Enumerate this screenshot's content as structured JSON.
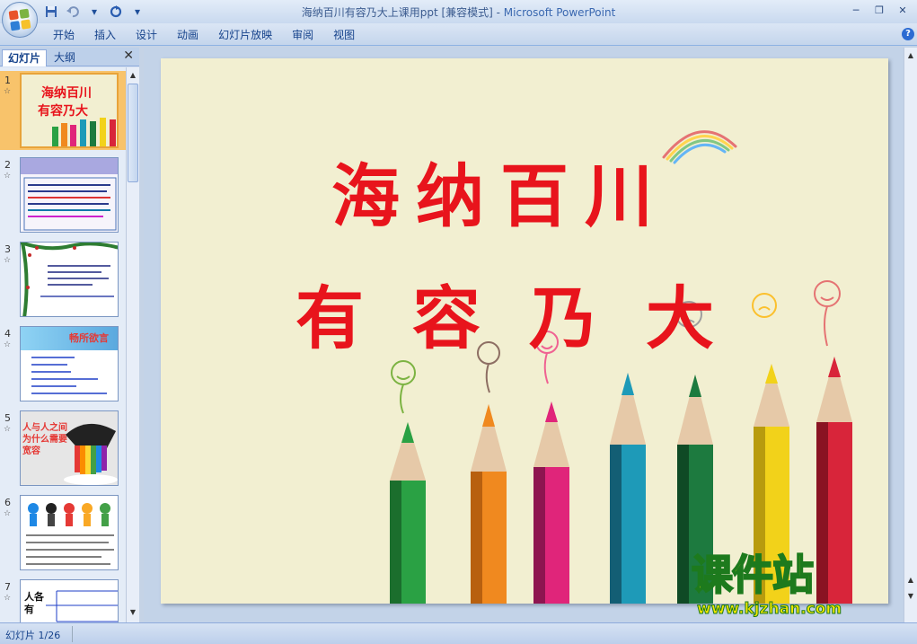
{
  "window": {
    "title": "海纳百川有容乃大上课用ppt [兼容模式]",
    "app_name": "Microsoft PowerPoint",
    "separator": " - "
  },
  "ribbon": {
    "tabs": [
      "开始",
      "插入",
      "设计",
      "动画",
      "幻灯片放映",
      "审阅",
      "视图"
    ]
  },
  "left_pane": {
    "tab_slides": "幻灯片",
    "tab_outline": "大纲",
    "slides": [
      {
        "num": "1",
        "selected": true
      },
      {
        "num": "2"
      },
      {
        "num": "3"
      },
      {
        "num": "4"
      },
      {
        "num": "5"
      },
      {
        "num": "6"
      },
      {
        "num": "7"
      }
    ],
    "thumb_texts": {
      "s1_line1": "海纳百川",
      "s1_line2": "有容乃大",
      "s4_header": "畅所欲言",
      "s5_text": "人与人之间为什么需要宽容",
      "s7_text": "人各有"
    }
  },
  "slide": {
    "line1": "海纳百川",
    "line2": "有容乃大"
  },
  "status": {
    "slide_counter": "幻灯片 1/26"
  },
  "watermark": {
    "brand": "课件站",
    "url": "www.kjzhan.com"
  },
  "colors": {
    "title_red": "#e8141c",
    "slide_bg": "#f2efd1",
    "pencils": [
      "#2aa144",
      "#f0891f",
      "#e0257a",
      "#1e9ab8",
      "#1d7a3f",
      "#f2d21a",
      "#d8253a"
    ]
  }
}
